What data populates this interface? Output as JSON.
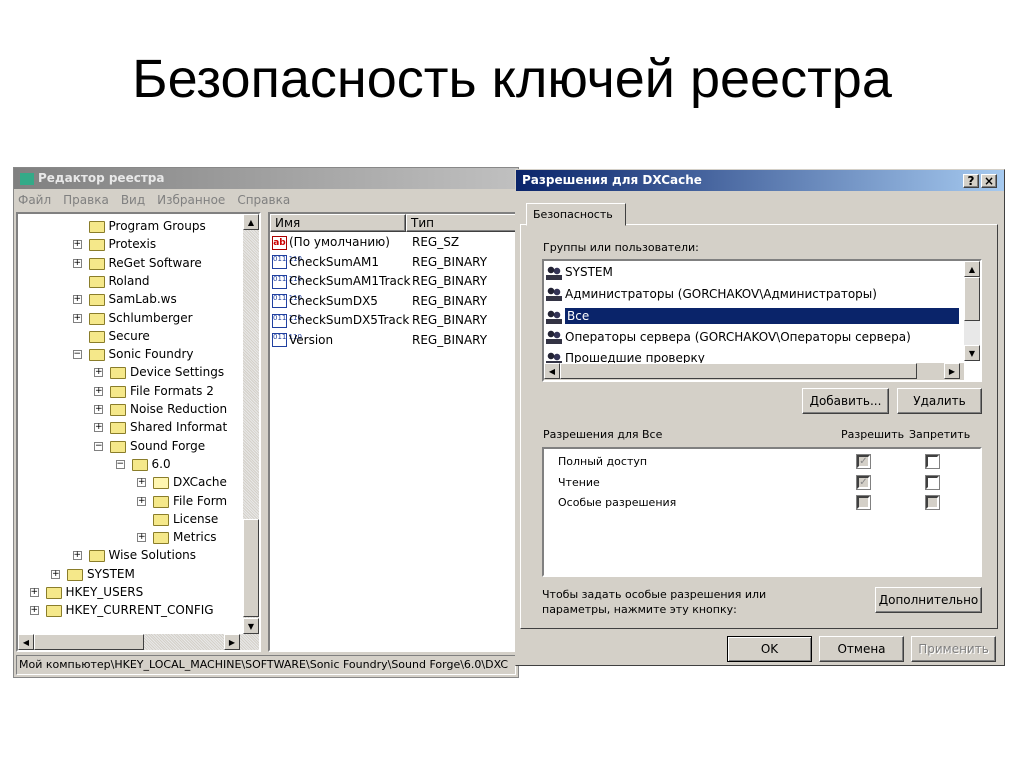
{
  "slide": {
    "title": "Безопасность ключей реестра"
  },
  "regedit": {
    "title": "Редактор реестра",
    "menu": [
      "Файл",
      "Правка",
      "Вид",
      "Избранное",
      "Справка"
    ],
    "tree": [
      {
        "label": "Program Groups",
        "level": 3,
        "expander": ""
      },
      {
        "label": "Protexis",
        "level": 3,
        "expander": "+"
      },
      {
        "label": "ReGet Software",
        "level": 3,
        "expander": "+"
      },
      {
        "label": "Roland",
        "level": 3,
        "expander": ""
      },
      {
        "label": "SamLab.ws",
        "level": 3,
        "expander": "+"
      },
      {
        "label": "Schlumberger",
        "level": 3,
        "expander": "+"
      },
      {
        "label": "Secure",
        "level": 3,
        "expander": ""
      },
      {
        "label": "Sonic Foundry",
        "level": 3,
        "expander": "-"
      },
      {
        "label": "Device Settings",
        "level": 4,
        "expander": "+"
      },
      {
        "label": "File Formats 2",
        "level": 4,
        "expander": "+"
      },
      {
        "label": "Noise Reduction",
        "level": 4,
        "expander": "+"
      },
      {
        "label": "Shared Informat",
        "level": 4,
        "expander": "+"
      },
      {
        "label": "Sound Forge",
        "level": 4,
        "expander": "-"
      },
      {
        "label": "6.0",
        "level": 5,
        "expander": "-"
      },
      {
        "label": "DXCache",
        "level": 6,
        "expander": "+",
        "open": true
      },
      {
        "label": "File Form",
        "level": 6,
        "expander": "+"
      },
      {
        "label": "License",
        "level": 6,
        "expander": ""
      },
      {
        "label": "Metrics",
        "level": 6,
        "expander": "+"
      },
      {
        "label": "Wise Solutions",
        "level": 3,
        "expander": "+"
      },
      {
        "label": "SYSTEM",
        "level": 2,
        "expander": "+"
      },
      {
        "label": "HKEY_USERS",
        "level": 1,
        "expander": "+"
      },
      {
        "label": "HKEY_CURRENT_CONFIG",
        "level": 1,
        "expander": "+"
      }
    ],
    "columns": {
      "name": "Имя",
      "type": "Тип"
    },
    "values": [
      {
        "name": "(По умолчанию)",
        "type": "REG_SZ",
        "icon": "ab"
      },
      {
        "name": "CheckSumAM1",
        "type": "REG_BINARY",
        "icon": "bin"
      },
      {
        "name": "CheckSumAM1Track",
        "type": "REG_BINARY",
        "icon": "bin"
      },
      {
        "name": "CheckSumDX5",
        "type": "REG_BINARY",
        "icon": "bin"
      },
      {
        "name": "CheckSumDX5Track",
        "type": "REG_BINARY",
        "icon": "bin"
      },
      {
        "name": "Version",
        "type": "REG_BINARY",
        "icon": "bin"
      }
    ],
    "status": "Мой компьютер\\HKEY_LOCAL_MACHINE\\SOFTWARE\\Sonic Foundry\\Sound Forge\\6.0\\DXC"
  },
  "dialog": {
    "title": "Разрешения для DXCache",
    "help": "?",
    "close": "×",
    "tab": "Безопасность",
    "groups_label": "Группы или пользователи:",
    "users": [
      {
        "label": "SYSTEM",
        "selected": false
      },
      {
        "label": "Администраторы (GORCHAKOV\\Администраторы)",
        "selected": false
      },
      {
        "label": "Все",
        "selected": true
      },
      {
        "label": "Операторы сервера (GORCHAKOV\\Операторы сервера)",
        "selected": false
      },
      {
        "label": "Прошедшие проверку",
        "selected": false
      }
    ],
    "add": "Добавить...",
    "remove": "Удалить",
    "perm_label": "Разрешения для Все",
    "allow": "Разрешить",
    "deny": "Запретить",
    "perms": [
      {
        "label": "Полный доступ",
        "allow": true,
        "deny": false,
        "disabled": false
      },
      {
        "label": "Чтение",
        "allow": true,
        "deny": false,
        "disabled": false
      },
      {
        "label": "Особые разрешения",
        "allow": false,
        "deny": false,
        "disabled": true
      }
    ],
    "hint": "Чтобы задать особые разрешения или\nпараметры, нажмите эту кнопку:",
    "advanced": "Дополнительно",
    "ok": "OK",
    "cancel": "Отмена",
    "apply": "Применить",
    "colors": {
      "title": "#0a246a",
      "selection": "#0a246a"
    }
  }
}
